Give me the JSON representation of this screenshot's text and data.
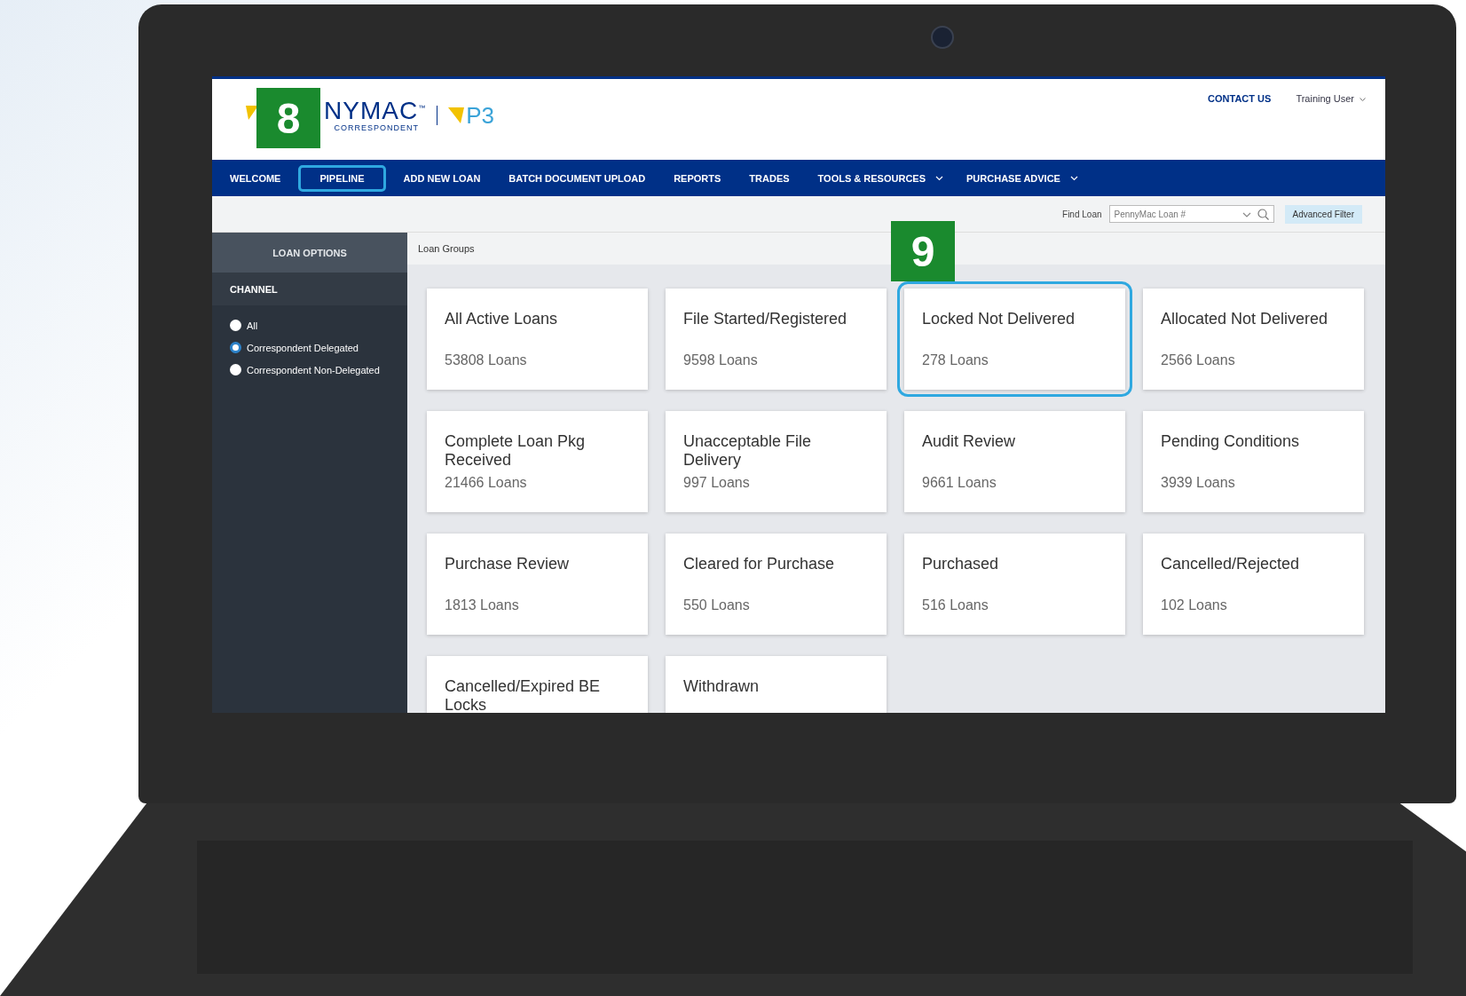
{
  "header": {
    "logo_text": "NYMAC$^{™}$",
    "logo_subtitle": "CORRESPONDENT",
    "product": "P3",
    "callout": "8",
    "contact": "CONTACT US",
    "user": "Training User"
  },
  "nav": [
    {
      "label": "WELCOME",
      "dropdown": false,
      "highlighted": false
    },
    {
      "label": "PIPELINE",
      "dropdown": false,
      "highlighted": true
    },
    {
      "label": "ADD NEW LOAN",
      "dropdown": false,
      "highlighted": false
    },
    {
      "label": "BATCH DOCUMENT UPLOAD",
      "dropdown": false,
      "highlighted": false
    },
    {
      "label": "REPORTS",
      "dropdown": false,
      "highlighted": false
    },
    {
      "label": "TRADES",
      "dropdown": false,
      "highlighted": false
    },
    {
      "label": "TOOLS & RESOURCES",
      "dropdown": true,
      "highlighted": false
    },
    {
      "label": "PURCHASE ADVICE",
      "dropdown": true,
      "highlighted": false
    }
  ],
  "find_loan": {
    "label": "Find Loan",
    "placeholder": "PennyMac Loan #",
    "button": "Advanced Filter"
  },
  "sidebar": {
    "title": "LOAN OPTIONS",
    "section": "CHANNEL",
    "options": [
      {
        "label": "All",
        "selected": false
      },
      {
        "label": "Correspondent Delegated",
        "selected": true
      },
      {
        "label": "Correspondent Non-Delegated",
        "selected": false
      }
    ]
  },
  "main": {
    "title": "Loan Groups",
    "cards": [
      {
        "title": "All Active Loans",
        "count": "53808 Loans",
        "highlighted": false
      },
      {
        "title": "File Started/Registered",
        "count": "9598 Loans",
        "highlighted": false
      },
      {
        "title": "Locked Not Delivered",
        "count": "278 Loans",
        "highlighted": true,
        "callout": "9"
      },
      {
        "title": "Allocated Not Delivered",
        "count": "2566 Loans",
        "highlighted": false
      },
      {
        "title": "Complete Loan Pkg Received",
        "count": "21466 Loans",
        "highlighted": false
      },
      {
        "title": "Unacceptable File Delivery",
        "count": "997 Loans",
        "highlighted": false
      },
      {
        "title": "Audit Review",
        "count": "9661 Loans",
        "highlighted": false
      },
      {
        "title": "Pending Conditions",
        "count": "3939 Loans",
        "highlighted": false
      },
      {
        "title": "Purchase Review",
        "count": "1813 Loans",
        "highlighted": false
      },
      {
        "title": "Cleared for Purchase",
        "count": "550 Loans",
        "highlighted": false
      },
      {
        "title": "Purchased",
        "count": "516 Loans",
        "highlighted": false
      },
      {
        "title": "Cancelled/Rejected",
        "count": "102 Loans",
        "highlighted": false
      },
      {
        "title": "Cancelled/Expired BE Locks",
        "highlighted": false
      },
      {
        "title": "Withdrawn",
        "highlighted": false
      }
    ]
  }
}
